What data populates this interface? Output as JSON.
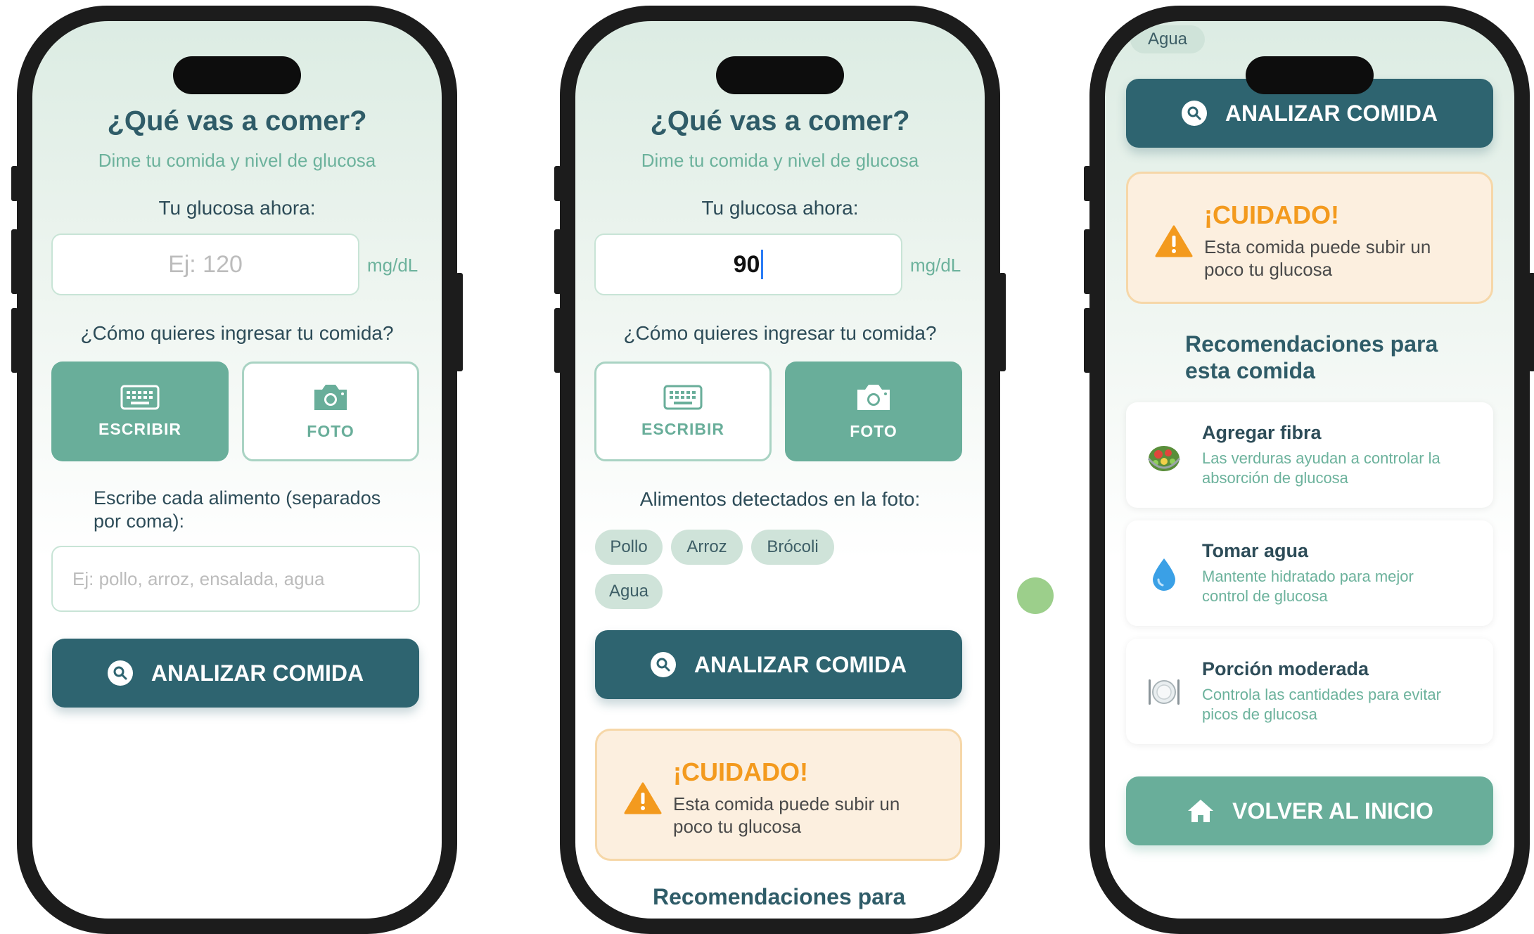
{
  "screen1": {
    "title": "¿Qué vas a comer?",
    "subtitle": "Dime tu comida y nivel de glucosa",
    "glucose_label": "Tu glucosa ahora:",
    "glucose_placeholder": "Ej: 120",
    "unit": "mg/dL",
    "mode_question": "¿Cómo quieres ingresar tu comida?",
    "mode_write": "ESCRIBIR",
    "mode_photo": "FOTO",
    "active_mode": "write",
    "food_label": "Escribe cada alimento (separados por coma):",
    "food_placeholder": "Ej: pollo, arroz, ensalada, agua",
    "analyze_label": "ANALIZAR COMIDA"
  },
  "screen2": {
    "title": "¿Qué vas a comer?",
    "subtitle": "Dime tu comida y nivel de glucosa",
    "glucose_label": "Tu glucosa ahora:",
    "glucose_value": "90",
    "unit": "mg/dL",
    "mode_question": "¿Cómo quieres ingresar tu comida?",
    "mode_write": "ESCRIBIR",
    "mode_photo": "FOTO",
    "active_mode": "photo",
    "detected_label": "Alimentos detectados en la foto:",
    "chips": [
      "Pollo",
      "Arroz",
      "Brócoli",
      "Agua"
    ],
    "analyze_label": "ANALIZAR COMIDA",
    "warning": {
      "title": "¡CUIDADO!",
      "text": "Esta comida puede subir un poco tu glucosa"
    },
    "recommend_title": "Recomendaciones para"
  },
  "screen3": {
    "chip_partial": "Agua",
    "analyze_label": "ANALIZAR COMIDA",
    "warning": {
      "title": "¡CUIDADO!",
      "text": "Esta comida puede subir un poco tu glucosa"
    },
    "recommend_title": "Recomendaciones para esta comida",
    "recommendations": [
      {
        "icon": "salad-icon",
        "title": "Agregar fibra",
        "desc": "Las verduras ayudan a controlar la absorción de glucosa"
      },
      {
        "icon": "water-drop-icon",
        "title": "Tomar agua",
        "desc": "Mantente hidratado para mejor control de glucosa"
      },
      {
        "icon": "plate-icon",
        "title": "Porción moderada",
        "desc": "Controla las cantidades para evitar picos de glucosa"
      }
    ],
    "home_label": "VOLVER AL INICIO"
  },
  "colors": {
    "primary_dark": "#2e6470",
    "primary_green": "#69ae9a",
    "warning_orange": "#f39a1e",
    "accent_dot": "#9ccf8b"
  }
}
